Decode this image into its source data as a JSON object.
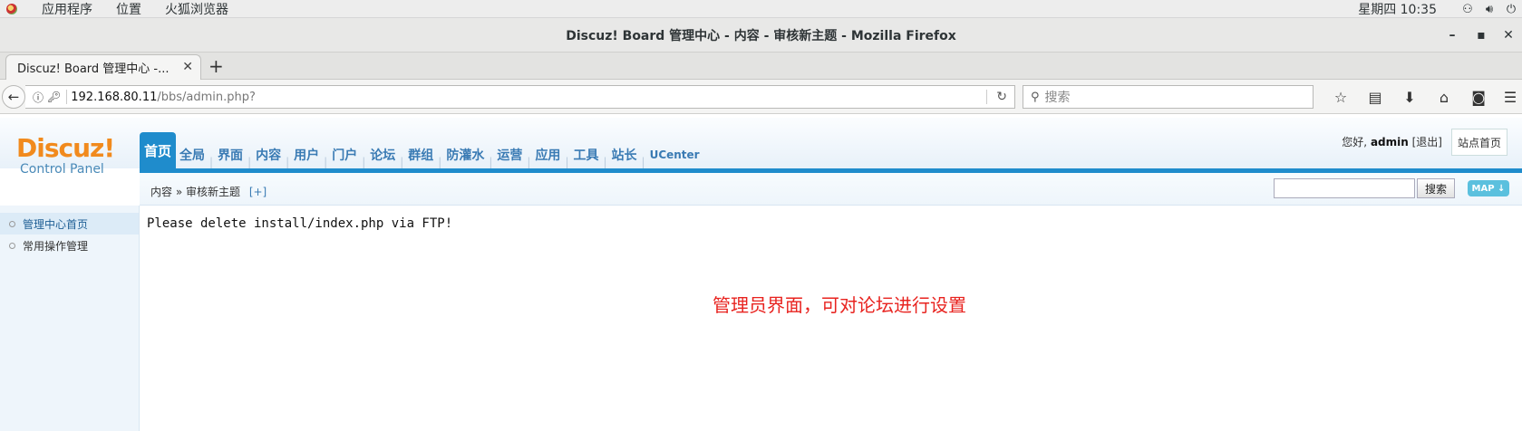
{
  "system_bar": {
    "menus": [
      "应用程序",
      "位置",
      "火狐浏览器"
    ],
    "clock": "星期四 10:35"
  },
  "window": {
    "title": "Discuz! Board 管理中心 - 内容 - 审核新主题 - Mozilla Firefox"
  },
  "tabs": [
    {
      "label": "Discuz! Board 管理中心 -..."
    }
  ],
  "address_bar": {
    "host": "192.168.80.11",
    "path": "/bbs/admin.php?"
  },
  "search_bar": {
    "placeholder": "搜索"
  },
  "admin": {
    "logo_main": "Discuz!",
    "logo_sub": "Control Panel",
    "nav": [
      "首页",
      "全局",
      "界面",
      "内容",
      "用户",
      "门户",
      "论坛",
      "群组",
      "防灌水",
      "运营",
      "应用",
      "工具",
      "站长",
      "UCenter"
    ],
    "active_nav": "首页",
    "greeting": "您好,",
    "username": "admin",
    "logout": "[退出]",
    "site_index": "站点首页",
    "breadcrumb": "内容 » 审核新主题",
    "breadcrumb_add": "[+]",
    "search_button": "搜索",
    "map_button": "MAP ↓",
    "sidebar": [
      "管理中心首页",
      "常用操作管理"
    ],
    "notice": "Please delete install/index.php via FTP!"
  },
  "annotation": "管理员界面，可对论坛进行设置",
  "colors": {
    "accent": "#1f8ccc",
    "logo": "#f18a1d",
    "annotation": "#e8231f"
  }
}
